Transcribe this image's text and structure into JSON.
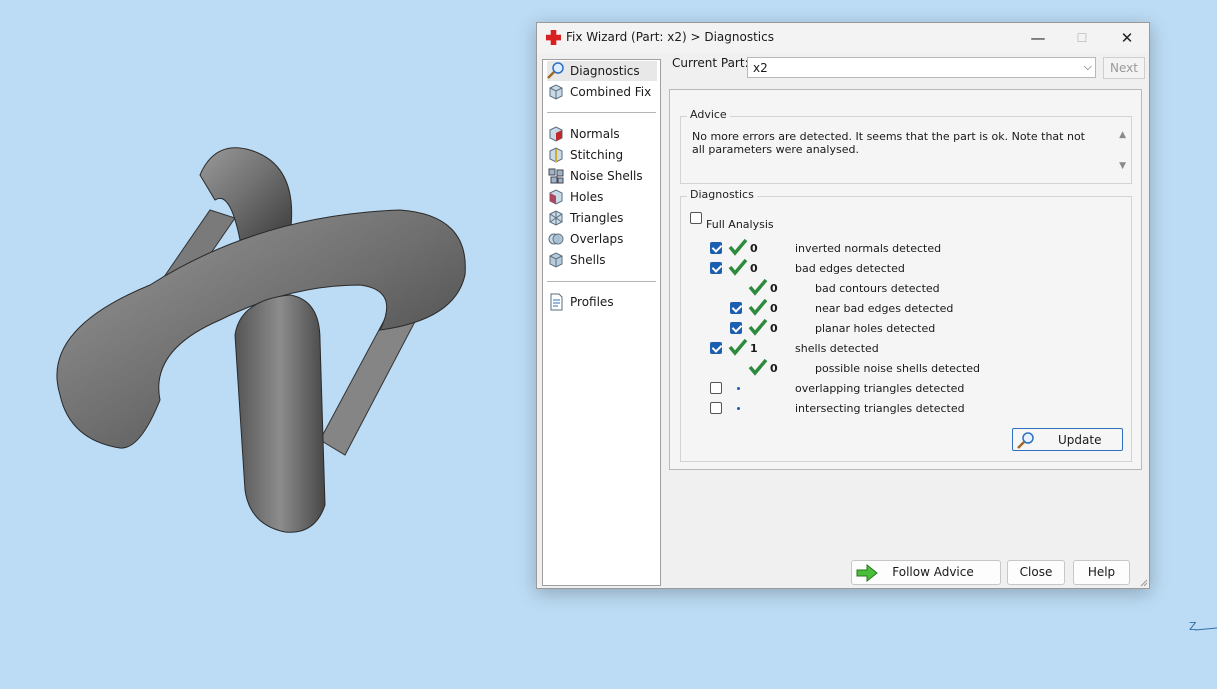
{
  "window": {
    "title": "Fix Wizard (Part: x2) > Diagnostics",
    "minimize_glyph": "—",
    "maximize_glyph": "☐",
    "close_glyph": "✕"
  },
  "nav": {
    "items": [
      {
        "label": "Diagnostics",
        "icon": "magnifier-icon",
        "selected": true
      },
      {
        "label": "Combined Fix",
        "icon": "combined-fix-cube-icon"
      },
      {
        "label": "Normals",
        "icon": "normals-cube-icon"
      },
      {
        "label": "Stitching",
        "icon": "stitching-cube-icon"
      },
      {
        "label": "Noise Shells",
        "icon": "noise-shells-cube-icon"
      },
      {
        "label": "Holes",
        "icon": "holes-cube-icon"
      },
      {
        "label": "Triangles",
        "icon": "triangles-cube-icon"
      },
      {
        "label": "Overlaps",
        "icon": "overlaps-cube-icon"
      },
      {
        "label": "Shells",
        "icon": "shells-cube-icon"
      },
      {
        "label": "Profiles",
        "icon": "profile-document-icon"
      }
    ]
  },
  "current_part": {
    "label": "Current Part:",
    "value": "x2",
    "next_label": "Next"
  },
  "advice": {
    "title": "Advice",
    "text": "No more errors are detected. It seems that the part is ok. Note that not all parameters were analysed."
  },
  "diagnostics": {
    "title": "Diagnostics",
    "full_analysis": {
      "label": "Full Analysis",
      "checked": false
    },
    "rows": [
      {
        "checkbox": true,
        "checked": true,
        "status": "ok",
        "count": "0",
        "label": "inverted normals detected"
      },
      {
        "checkbox": true,
        "checked": true,
        "status": "ok",
        "count": "0",
        "label": "bad edges detected"
      },
      {
        "checkbox": false,
        "status": "ok",
        "count": "0",
        "label": "bad contours detected"
      },
      {
        "checkbox": true,
        "checked": true,
        "status": "ok",
        "count": "0",
        "label": "near bad edges detected"
      },
      {
        "checkbox": true,
        "checked": true,
        "status": "ok",
        "count": "0",
        "label": "planar holes detected"
      },
      {
        "checkbox": true,
        "checked": true,
        "status": "ok",
        "count": "1",
        "label": "shells detected"
      },
      {
        "checkbox": false,
        "status": "ok",
        "count": "0",
        "label": "possible noise shells detected"
      },
      {
        "checkbox": true,
        "checked": false,
        "status": "pending",
        "count": "",
        "label": "overlapping triangles detected"
      },
      {
        "checkbox": true,
        "checked": false,
        "status": "pending",
        "count": "",
        "label": "intersecting triangles detected"
      }
    ],
    "update_label": "Update"
  },
  "buttons": {
    "follow_advice": "Follow Advice",
    "close": "Close",
    "help": "Help"
  },
  "viewport": {
    "axis_label": "Z"
  },
  "colors": {
    "background": "#bcdcf5",
    "accent": "#1c5fb0",
    "check_green": "#2e8b3e"
  }
}
